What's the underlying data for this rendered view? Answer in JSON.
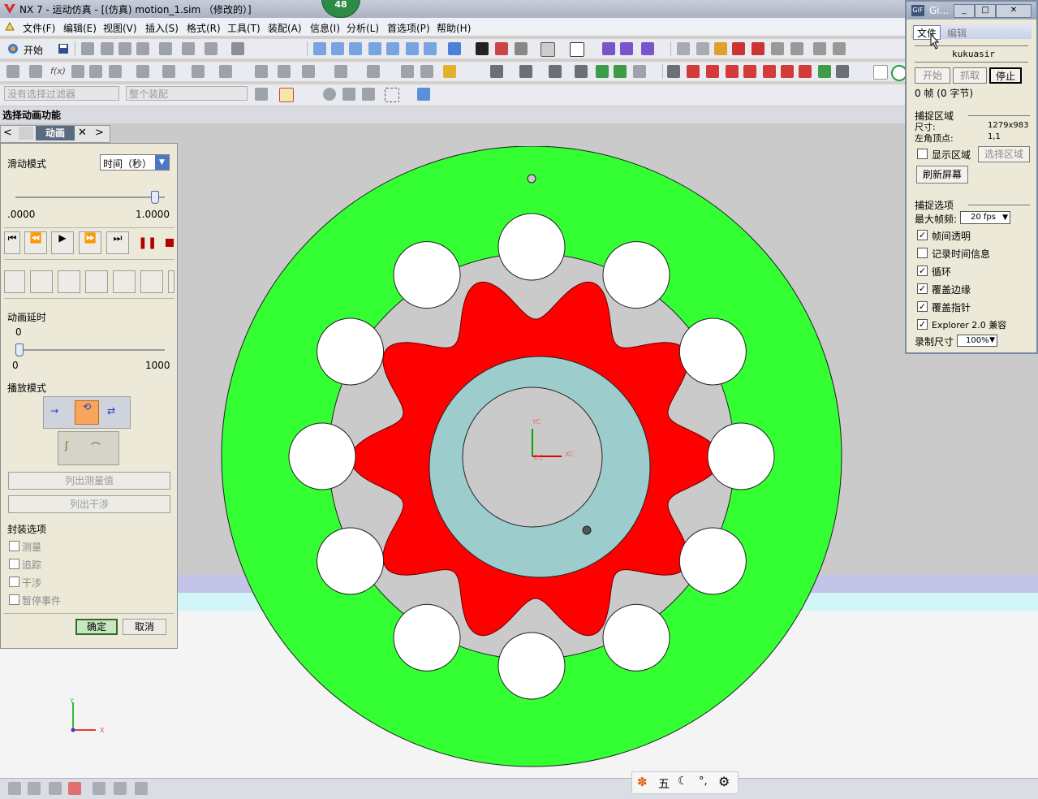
{
  "window": {
    "title": "NX 7 - 运动仿真 - [(仿真) motion_1.sim （修改的）]",
    "badge": "48"
  },
  "menu": [
    "文件(F)",
    "编辑(E)",
    "视图(V)",
    "插入(S)",
    "格式(R)",
    "工具(T)",
    "装配(A)",
    "信息(I)",
    "分析(L)",
    "首选项(P)",
    "帮助(H)"
  ],
  "toolbar": {
    "start_label": "开始"
  },
  "filters": {
    "selection_filter": "没有选择过滤器",
    "assembly_scope": "整个装配"
  },
  "section_header": "选择动画功能",
  "tab": {
    "label": "动画"
  },
  "panel": {
    "slider_mode_label": "滑动模式",
    "slider_mode_value": "时间（秒）",
    "time_min": ".0000",
    "time_max": "1.0000",
    "time_position": 0.93,
    "delay_label": "动画延时",
    "delay_value": "0",
    "delay_min": "0",
    "delay_max": "1000",
    "delay_position": 0.0,
    "playback_label": "播放模式",
    "list_measures": "列出测量值",
    "list_interference": "列出干涉",
    "package_label": "封装选项",
    "options": [
      "测量",
      "追踪",
      "干涉",
      "暂停事件"
    ],
    "ok": "确定",
    "cancel": "取消"
  },
  "gif": {
    "title": "Gi...",
    "menu_file": "文件",
    "menu_edit": "编辑",
    "user": "kukuasir",
    "btn_start": "开始",
    "btn_grab": "抓取",
    "btn_stop": "停止",
    "frames": "0 帧 (0 字节)",
    "capture_area": "捕捉区域",
    "size_label": "尺寸:",
    "size_value": "1279x983",
    "corner_label": "左角顶点:",
    "corner_value": "1,1",
    "show_area": "显示区域",
    "select_area": "选择区域",
    "refresh": "刷新屏幕",
    "capture_options": "捕捉选项",
    "max_fps_label": "最大帧频:",
    "max_fps_value": "20 fps",
    "opts": [
      {
        "label": "帧间透明",
        "checked": true
      },
      {
        "label": "记录时间信息",
        "checked": false
      },
      {
        "label": "循环",
        "checked": true
      },
      {
        "label": "覆盖边缘",
        "checked": true
      },
      {
        "label": "覆盖指针",
        "checked": true
      },
      {
        "label": "Explorer 2.0 兼容",
        "checked": true
      }
    ],
    "rec_size_label": "录制尺寸",
    "rec_size_value": "100%"
  },
  "viewport": {
    "axis_labels": {
      "yc": "YC",
      "xc": "XC",
      "zc": "ZC",
      "y": "Y",
      "x": "X"
    },
    "colors": {
      "outer_ring": "#33ff33",
      "gear": "#ff0000",
      "hub": "#9ccccc",
      "background": "#cacaca"
    }
  },
  "ime": {
    "char": "五"
  }
}
